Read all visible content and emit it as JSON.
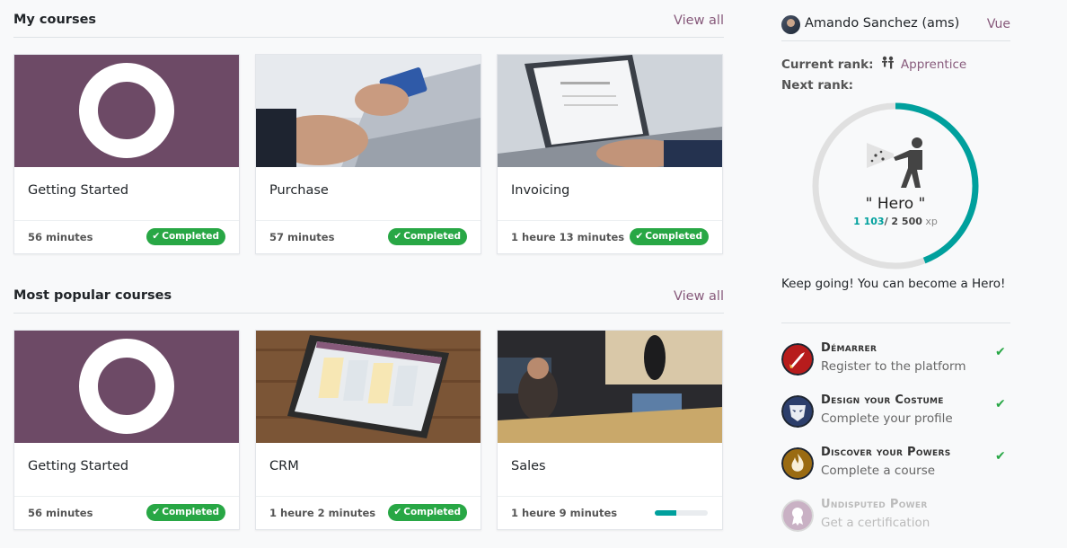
{
  "my_courses": {
    "title": "My courses",
    "view_all": "View all",
    "cards": [
      {
        "title": "Getting Started",
        "duration": "56 minutes",
        "status": "Completed"
      },
      {
        "title": "Purchase",
        "duration": "57 minutes",
        "status": "Completed"
      },
      {
        "title": "Invoicing",
        "duration": "1 heure 13 minutes",
        "status": "Completed"
      }
    ]
  },
  "popular_courses": {
    "title": "Most popular courses",
    "view_all": "View all",
    "cards": [
      {
        "title": "Getting Started",
        "duration": "56 minutes",
        "status": "Completed"
      },
      {
        "title": "CRM",
        "duration": "1 heure 2 minutes",
        "status": "Completed"
      },
      {
        "title": "Sales",
        "duration": "1 heure 9 minutes",
        "progress_percent": 40
      }
    ]
  },
  "user": {
    "name": "Amando Sanchez (ams)",
    "view_link": "Vue",
    "current_rank_label": "Current rank:",
    "current_rank": "Apprentice",
    "next_rank_label": "Next rank:",
    "next_rank_name": "\" Hero \"",
    "xp_current": "1 103",
    "xp_max": "/ 2 500",
    "xp_unit": "xp",
    "xp_progress_fraction": 0.441,
    "encouragement": "Keep going! You can become a Hero!"
  },
  "badges": [
    {
      "title": "Démarrer",
      "description": "Register to the platform",
      "earned": true,
      "icon": "rocket-badge-icon",
      "color": "#b71c1c"
    },
    {
      "title": "Design your Costume",
      "description": "Complete your profile",
      "earned": true,
      "icon": "mask-badge-icon",
      "color": "#2c3e6b"
    },
    {
      "title": "Discover your Powers",
      "description": "Complete a course",
      "earned": true,
      "icon": "flame-badge-icon",
      "color": "#9a6b12"
    },
    {
      "title": "Undisputed Power",
      "description": "Get a certification",
      "earned": false,
      "icon": "ribbon-badge-icon",
      "color": "#c9b1c4"
    }
  ],
  "colors": {
    "accent": "#875a7b",
    "teal": "#00a09d",
    "success": "#28a745"
  }
}
